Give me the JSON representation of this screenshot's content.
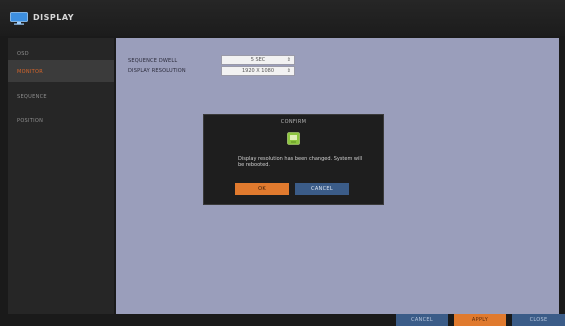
{
  "window": {
    "title": "DISPLAY",
    "icon": "monitor-icon"
  },
  "sidebar": {
    "items": [
      {
        "label": "OSD",
        "active": false
      },
      {
        "label": "MONITOR",
        "active": true
      },
      {
        "label": "SEQUENCE",
        "active": false
      },
      {
        "label": "POSITION",
        "active": false
      }
    ]
  },
  "monitor": {
    "sequence_dwell": {
      "label": "SEQUENCE DWELL",
      "value": "5 SEC"
    },
    "display_resolution": {
      "label": "DISPLAY RESOLUTION",
      "value": "1920 X 1080"
    }
  },
  "dialog": {
    "title": "CONFIRM",
    "icon": "confirm-icon",
    "message": "Display resolution has been changed. System will be rebooted.",
    "ok_label": "OK",
    "cancel_label": "CANCEL"
  },
  "footer": {
    "cancel_label": "CANCEL",
    "apply_label": "APPLY",
    "close_label": "CLOSE"
  },
  "colors": {
    "accent": "#e07a2e",
    "button_blue": "#3b5c88",
    "content_bg": "#9a9ebb",
    "dark_bg": "#1a1a1a"
  }
}
